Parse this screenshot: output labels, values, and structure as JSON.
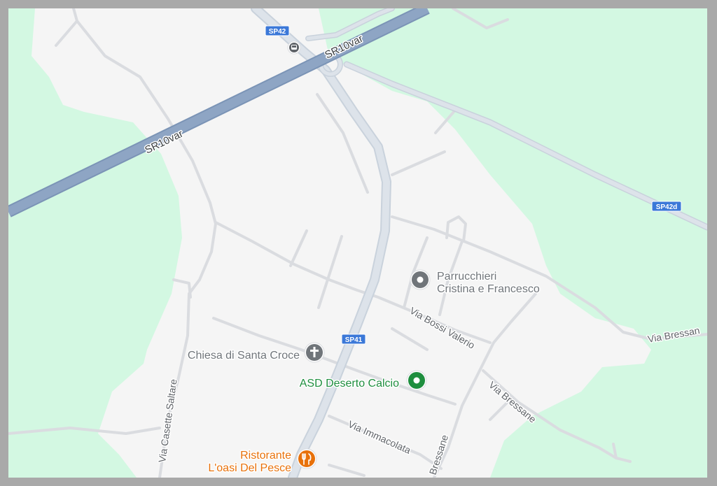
{
  "colors": {
    "frame": "#a9a9a9",
    "green_area": "#d3f8e2",
    "urban_area": "#f5f5f5",
    "minor_road": "#dadce0",
    "major_road": "#c7d0da",
    "highway": "#8aa2c2",
    "shield": "#3b78d8",
    "poi_gray": "#70757a",
    "poi_green": "#1e8e3e",
    "poi_orange": "#e8710a"
  },
  "shields": {
    "sp42": "SP42",
    "sp42d": "SP42d",
    "sp41": "SP41"
  },
  "road_labels": {
    "sr10var_top": "SR10var",
    "sr10var_left": "SR10var",
    "via_bressan_east": "Via Bressan",
    "via_bossi_valerio": "Via Bossi Valerio",
    "via_bressane_diag": "Via Bressane",
    "via_immacolata": "Via Immacolata",
    "bressane_vertical": "Bressane",
    "via_casette_saltare": "Via Casette Saltare"
  },
  "pois": {
    "bus_stop": {
      "icon": "bus-icon"
    },
    "parrucchieri": {
      "line1": "Parrucchieri",
      "line2": "Cristina e Francesco",
      "icon": "pin-icon"
    },
    "chiesa": {
      "name": "Chiesa di Santa Croce",
      "icon": "cross-icon"
    },
    "asd": {
      "name": "ASD Deserto Calcio",
      "icon": "sports-pin-icon"
    },
    "ristorante": {
      "line1": "Ristorante",
      "line2": "L'oasi Del Pesce",
      "icon": "restaurant-icon"
    }
  }
}
